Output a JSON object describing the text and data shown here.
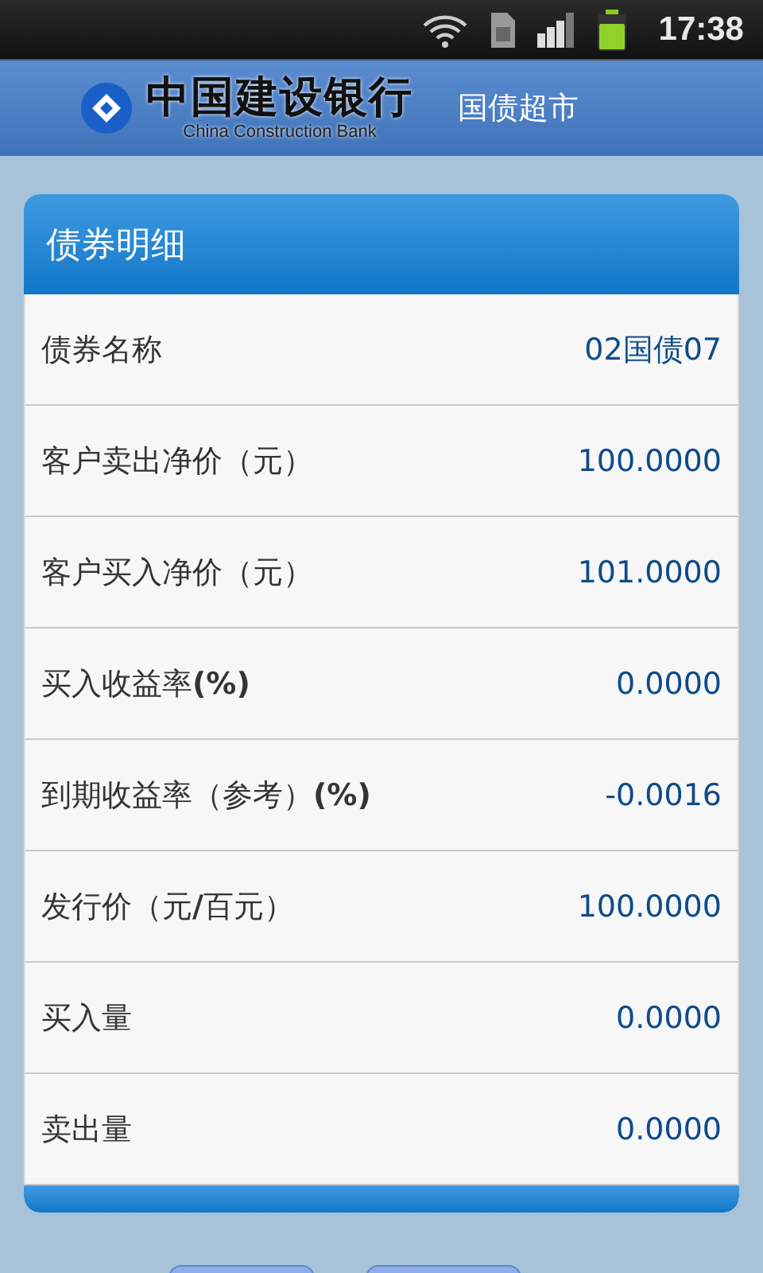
{
  "status_bar": {
    "time": "17:38"
  },
  "header": {
    "bank_name": "中国建设银行",
    "bank_name_en": "China Construction Bank",
    "section": "国债超市"
  },
  "card": {
    "title": "债券明细",
    "rows": [
      {
        "label": "债券名称",
        "value": "02国债07"
      },
      {
        "label": "客户卖出净价（元）",
        "value": "100.0000"
      },
      {
        "label": "客户买入净价（元）",
        "value": "101.0000"
      },
      {
        "label": "买入收益率**(%)**",
        "value": "0.0000"
      },
      {
        "label": "到期收益率（参考）**(%)**",
        "value": "-0.0016"
      },
      {
        "label": "发行价（元**/**百元）",
        "value": "100.0000"
      },
      {
        "label": "买入量",
        "value": "0.0000"
      },
      {
        "label": "卖出量",
        "value": "0.0000"
      }
    ]
  },
  "buttons": [
    {
      "kind": "button"
    },
    {
      "kind": "button"
    }
  ]
}
